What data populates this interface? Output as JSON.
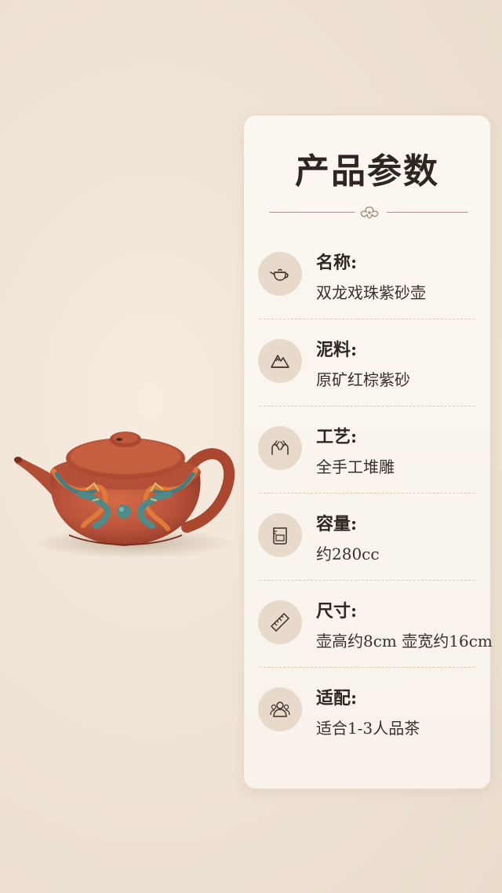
{
  "card": {
    "title": "产品参数"
  },
  "specs": [
    {
      "icon": "teapot-icon",
      "label": "名称:",
      "value": "双龙戏珠紫砂壶"
    },
    {
      "icon": "mountain-icon",
      "label": "泥料:",
      "value": "原矿红棕紫砂"
    },
    {
      "icon": "hands-icon",
      "label": "工艺:",
      "value": "全手工堆雕"
    },
    {
      "icon": "measuring-cup-icon",
      "label": "容量:",
      "value": "约280cc"
    },
    {
      "icon": "ruler-icon",
      "label": "尺寸:",
      "value": "壶高约8cm  壶宽约16cm"
    },
    {
      "icon": "people-icon",
      "label": "适配:",
      "value": "适合1-3人品茶"
    }
  ],
  "colors": {
    "background": "#efe3d4",
    "card": "#f8f2ea",
    "icon_circle": "#e7dacb",
    "text": "#2f2622",
    "clay": "#b9523a"
  }
}
